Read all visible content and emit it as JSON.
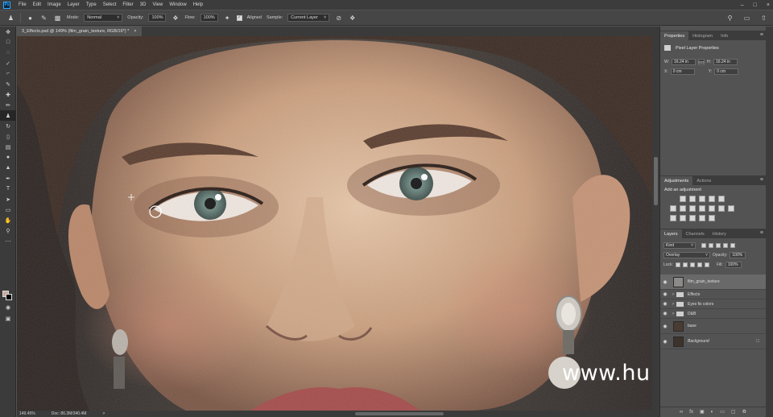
{
  "menubar": {
    "app_badge": "Ps",
    "items": [
      "File",
      "Edit",
      "Image",
      "Layer",
      "Type",
      "Select",
      "Filter",
      "3D",
      "View",
      "Window",
      "Help"
    ]
  },
  "options": {
    "mode_label": "Mode:",
    "mode_value": "Normal",
    "opacity_label": "Opacity:",
    "opacity_value": "100%",
    "flow_label": "Flow:",
    "flow_value": "100%",
    "aligned_label": "Aligned",
    "sample_label": "Sample:",
    "sample_value": "Current Layer"
  },
  "document": {
    "tab_title": "3_Effects.psd @ 149% (film_grain_texture, RGB/16*) *",
    "close_glyph": "×",
    "watermark": "www.hunls.com"
  },
  "status": {
    "zoom": "149.45%",
    "doc_size": "Doc: 86.3M/340.4M"
  },
  "properties_panel": {
    "tabs": [
      "Properties",
      "Histogram",
      "Info"
    ],
    "heading": "Pixel Layer Properties",
    "w_label": "W:",
    "w_value": "16.24 in",
    "h_label": "H:",
    "h_value": "16.24 in",
    "go_label": "GO",
    "x_label": "X:",
    "x_value": "0 cm",
    "y_label": "Y:",
    "y_value": "0 cm"
  },
  "adjustments_panel": {
    "tabs": [
      "Adjustments",
      "Actions"
    ],
    "heading": "Add an adjustment"
  },
  "layers_panel": {
    "tabs": [
      "Layers",
      "Channels",
      "History"
    ],
    "kind_value": "Kind",
    "blend_mode": "Overlay",
    "opacity_label": "Opacity:",
    "opacity_value": "100%",
    "lock_label": "Lock:",
    "fill_label": "Fill:",
    "fill_value": "100%",
    "layers": [
      {
        "name": "film_grain_texture",
        "type": "pixel",
        "selected": true
      },
      {
        "name": "Effects",
        "type": "group",
        "selected": false
      },
      {
        "name": "Eyes fix colors",
        "type": "group",
        "selected": false
      },
      {
        "name": "D&B",
        "type": "group",
        "selected": false
      },
      {
        "name": "base",
        "type": "pixel",
        "selected": false
      },
      {
        "name": "Background",
        "type": "pixel",
        "selected": false
      }
    ]
  },
  "colors": {
    "foreground": "#c9a99a",
    "background": "#000000",
    "app_dark": "#3c3c3c",
    "panel": "#535353"
  }
}
